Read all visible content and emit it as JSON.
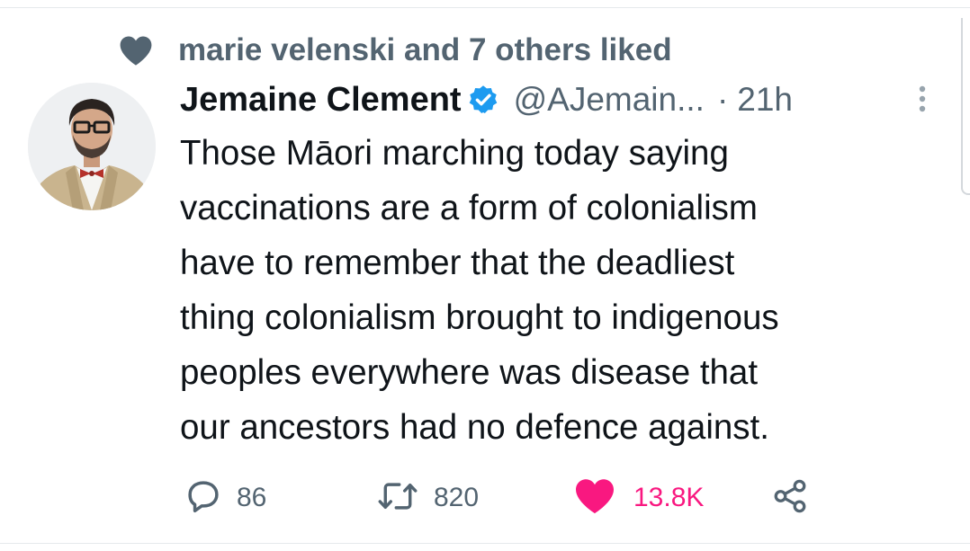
{
  "context": {
    "liked_by_text": "marie velenski and 7 others liked"
  },
  "author": {
    "display_name": "Jemaine Clement",
    "handle": "@AJemain...",
    "separator": "·",
    "time": "21h",
    "verified": true
  },
  "tweet": {
    "lines": [
      "Those Māori marching today saying",
      "vaccinations are a form of colonialism",
      "have to remember that the deadliest",
      "thing colonialism brought to indigenous",
      "peoples everywhere was disease that",
      "our ancestors had no defence against."
    ]
  },
  "actions": {
    "reply_count": "86",
    "retweet_count": "820",
    "like_count": "13.8K",
    "liked": true
  },
  "icons": {
    "context": "heart-icon",
    "verified": "verified-badge-icon",
    "more": "more-vertical-icon",
    "reply": "reply-icon",
    "retweet": "retweet-icon",
    "like": "heart-filled-icon",
    "share": "share-icon"
  },
  "colors": {
    "text": "#0f1419",
    "secondary_text": "#536471",
    "context_heart": "#536471",
    "verified_blue": "#1d9bf0",
    "like_pink": "#f91880"
  }
}
